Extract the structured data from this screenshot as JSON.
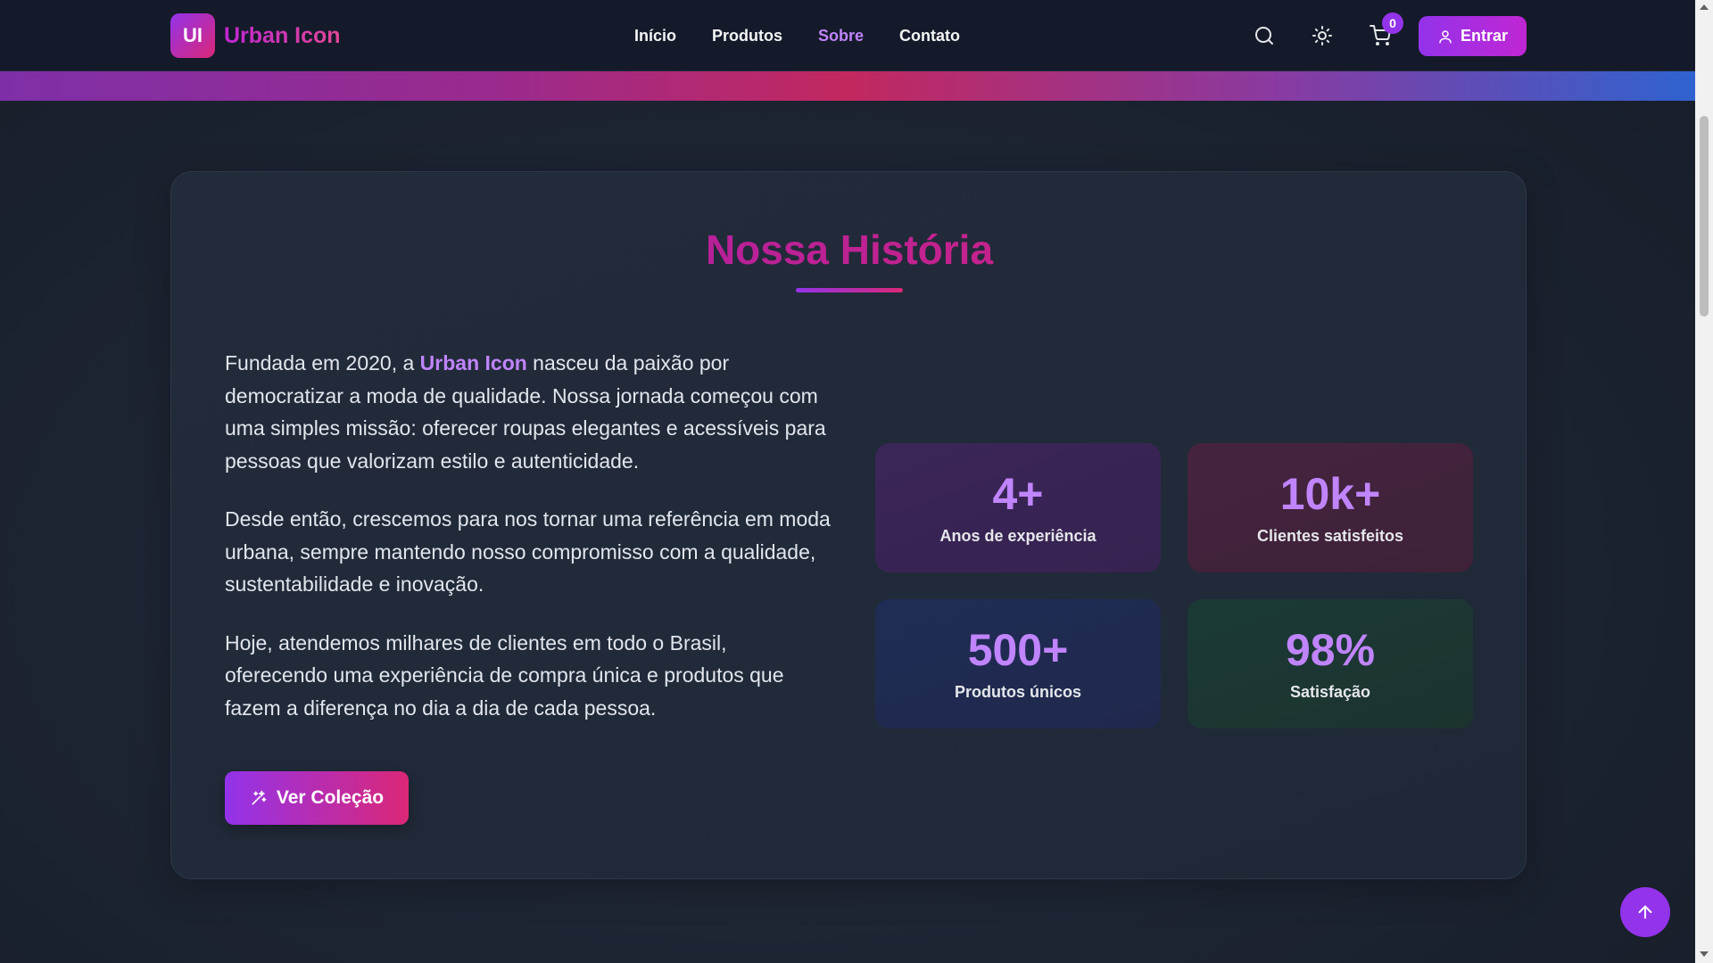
{
  "header": {
    "logo_badge": "UI",
    "logo_text": "Urban Icon",
    "nav": [
      {
        "label": "Início"
      },
      {
        "label": "Produtos"
      },
      {
        "label": "Sobre",
        "active": true
      },
      {
        "label": "Contato"
      }
    ],
    "icons": [
      "search-icon",
      "sun-icon",
      "cart-icon"
    ],
    "cart_count": "0",
    "login_label": "Entrar"
  },
  "about": {
    "title": "Nossa História",
    "p1_before": "Fundada em 2020, a ",
    "p1_brand": "Urban Icon",
    "p1_after": " nasceu da paixão por democratizar a moda de qualidade. Nossa jornada começou com uma simples missão: oferecer roupas elegantes e acessíveis para pessoas que valorizam estilo e autenticidade.",
    "p2": "Desde então, crescemos para nos tornar uma referência em moda urbana, sempre mantendo nosso compromisso com a qualidade, sustentabilidade e inovação.",
    "p3": "Hoje, atendemos milhares de clientes em todo o Brasil, oferecendo uma experiência de compra única e produtos que fazem a diferença no dia a dia de cada pessoa.",
    "cta_label": "Ver Coleção",
    "stats": [
      {
        "value": "4+",
        "label": "Anos de experiência"
      },
      {
        "value": "10k+",
        "label": "Clientes satisfeitos"
      },
      {
        "value": "500+",
        "label": "Produtos únicos"
      },
      {
        "value": "98%",
        "label": "Satisfação"
      }
    ]
  },
  "colors": {
    "accent": "#9333ea",
    "accent_pink": "#db2777",
    "header_bg": "#141a29",
    "page_bg": "#1b2230"
  }
}
